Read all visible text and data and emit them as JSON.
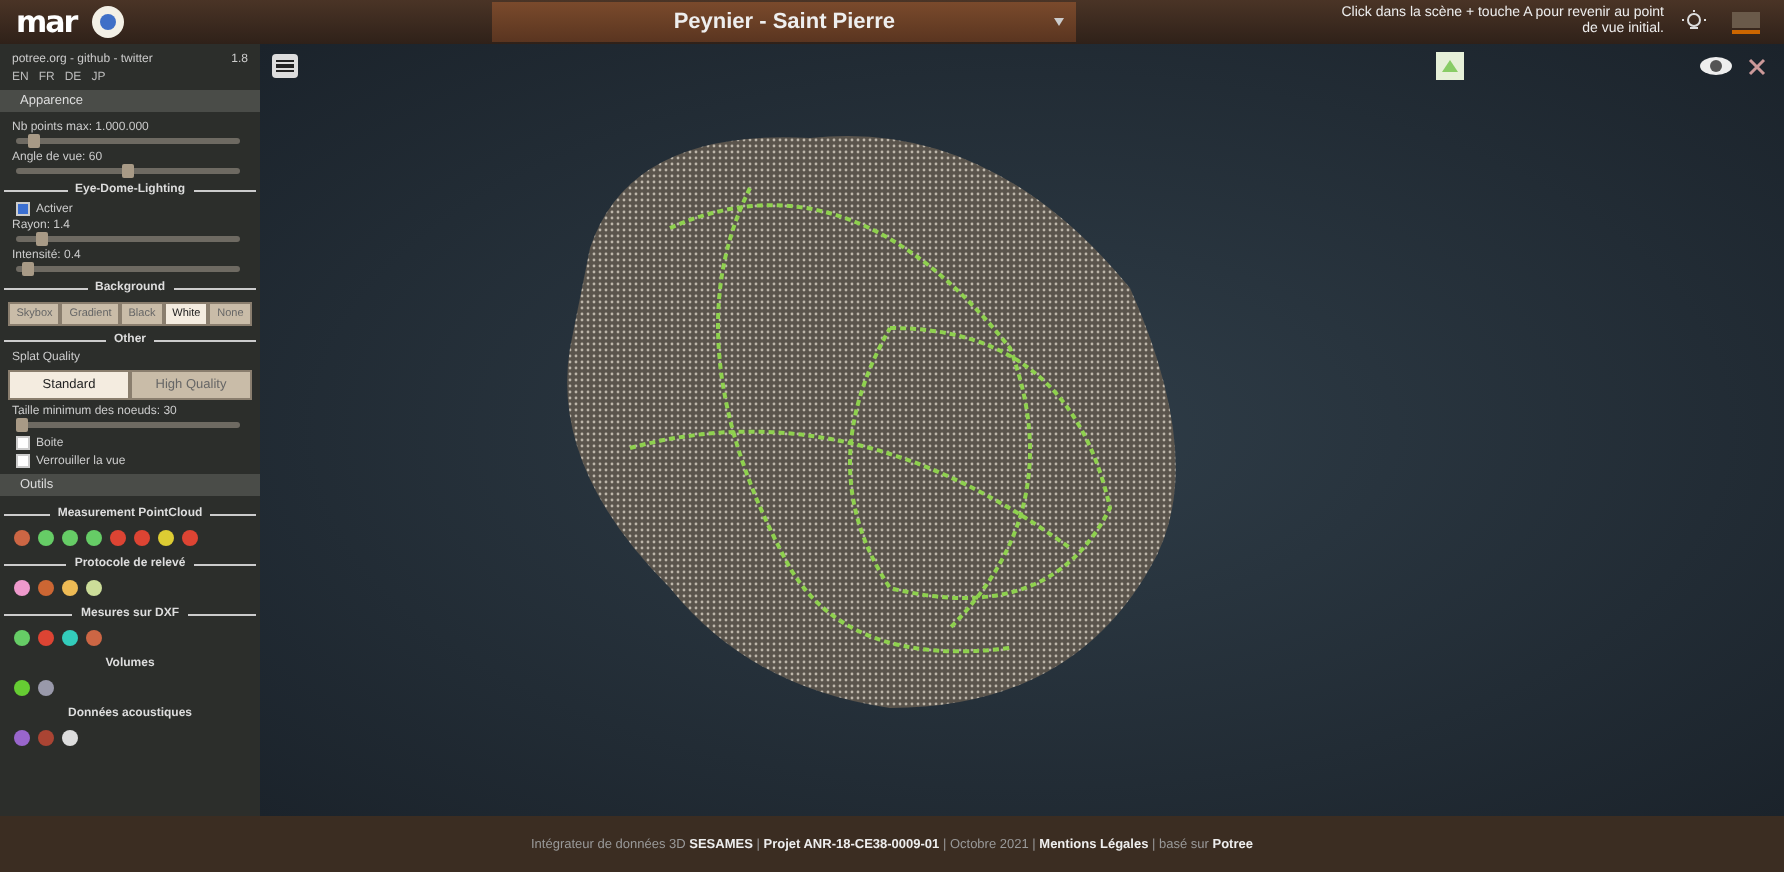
{
  "header": {
    "logo": "mar",
    "location": "Peynier - Saint Pierre",
    "hint": "Click dans la scène + touche A pour revenir au point de vue initial."
  },
  "sidebar": {
    "links": "potree.org - github - twitter",
    "version": "1.8",
    "languages": [
      "EN",
      "FR",
      "DE",
      "JP"
    ],
    "appearance": {
      "title": "Apparence",
      "sliders_top": [
        {
          "label": "Nb points max: 1.000.000",
          "level": 0.08
        },
        {
          "label": "Angle de vue: 60",
          "level": 0.5
        }
      ],
      "edl": {
        "title": "Eye-Dome-Lighting",
        "enable": {
          "label": "Activer",
          "checked": true
        },
        "sliders": [
          {
            "label": "Rayon: 1.4",
            "level": 0.12
          },
          {
            "label": "Intensité: 0.4",
            "level": 0.05
          }
        ]
      },
      "background": {
        "title": "Background",
        "options": [
          {
            "label": "Skybox",
            "selected": false
          },
          {
            "label": "Gradient",
            "selected": false
          },
          {
            "label": "Black",
            "selected": false
          },
          {
            "label": "White",
            "selected": true
          },
          {
            "label": "None",
            "selected": false
          }
        ]
      },
      "other": {
        "title": "Other",
        "splat_label": "Splat Quality",
        "splat_options": [
          {
            "label": "Standard",
            "selected": true
          },
          {
            "label": "High Quality",
            "selected": false
          }
        ],
        "node_slider": {
          "label": "Taille minimum des noeuds: 30",
          "level": 0.03
        },
        "checkboxes": [
          {
            "label": "Boite",
            "checked": false
          },
          {
            "label": "Verrouiller la vue",
            "checked": false
          }
        ]
      }
    },
    "tools": {
      "title": "Outils",
      "groups": [
        {
          "title": "Measurement PointCloud"
        },
        {
          "title": "Protocole de relevé"
        },
        {
          "title": "Mesures sur DXF"
        },
        {
          "title": "Volumes"
        },
        {
          "title": "Données acoustiques"
        }
      ]
    }
  },
  "footer": "Intégrateur de données 3D **SESAMES** | **Projet ANR-18-CE38-0009-01** | Octobre 2021 | **Mentions Légales** | basé sur **Potree**"
}
